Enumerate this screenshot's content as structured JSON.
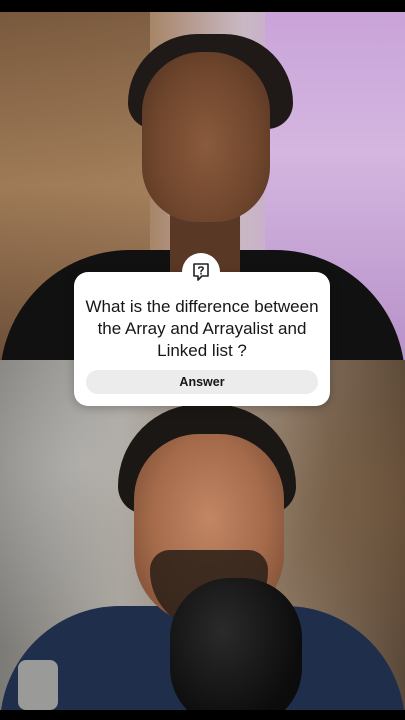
{
  "question_card": {
    "icon": "question-mark-icon",
    "question_text": "What is the difference between the Array and Arrayalist and Linked list ?",
    "answer_label": "Answer"
  },
  "colors": {
    "card_background": "#ffffff",
    "answer_button_background": "#ececec",
    "text": "#161616"
  }
}
